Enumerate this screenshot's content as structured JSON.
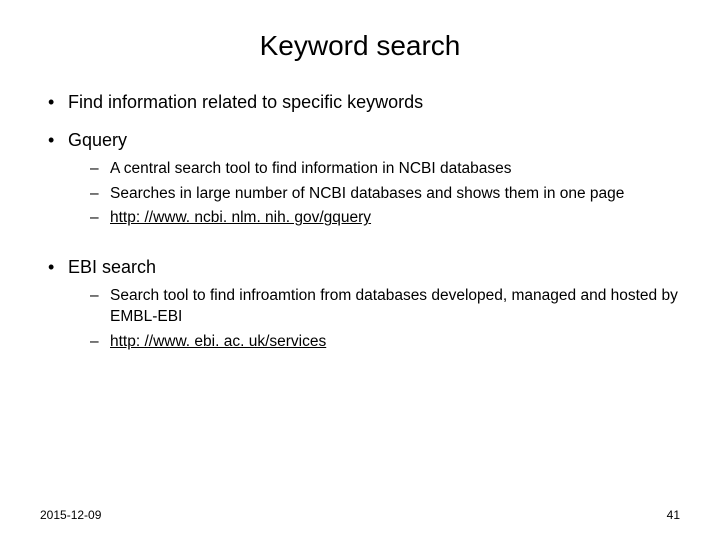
{
  "title": "Keyword search",
  "bullets": [
    {
      "text": "Find information related to specific keywords"
    },
    {
      "text": "Gquery",
      "sub": [
        {
          "text": "A central search tool to find information in NCBI databases"
        },
        {
          "text": "Searches in large number of NCBI databases and shows them in one page"
        },
        {
          "text": "http: //www. ncbi. nlm. nih. gov/gquery",
          "link": true
        }
      ]
    },
    {
      "text": "EBI search",
      "sub": [
        {
          "text": "Search tool to find infroamtion from databases developed, managed and hosted by EMBL-EBI"
        },
        {
          "text": "http: //www. ebi. ac. uk/services",
          "link": true
        }
      ]
    }
  ],
  "footer_date": "2015-12-09",
  "page_number": "41"
}
